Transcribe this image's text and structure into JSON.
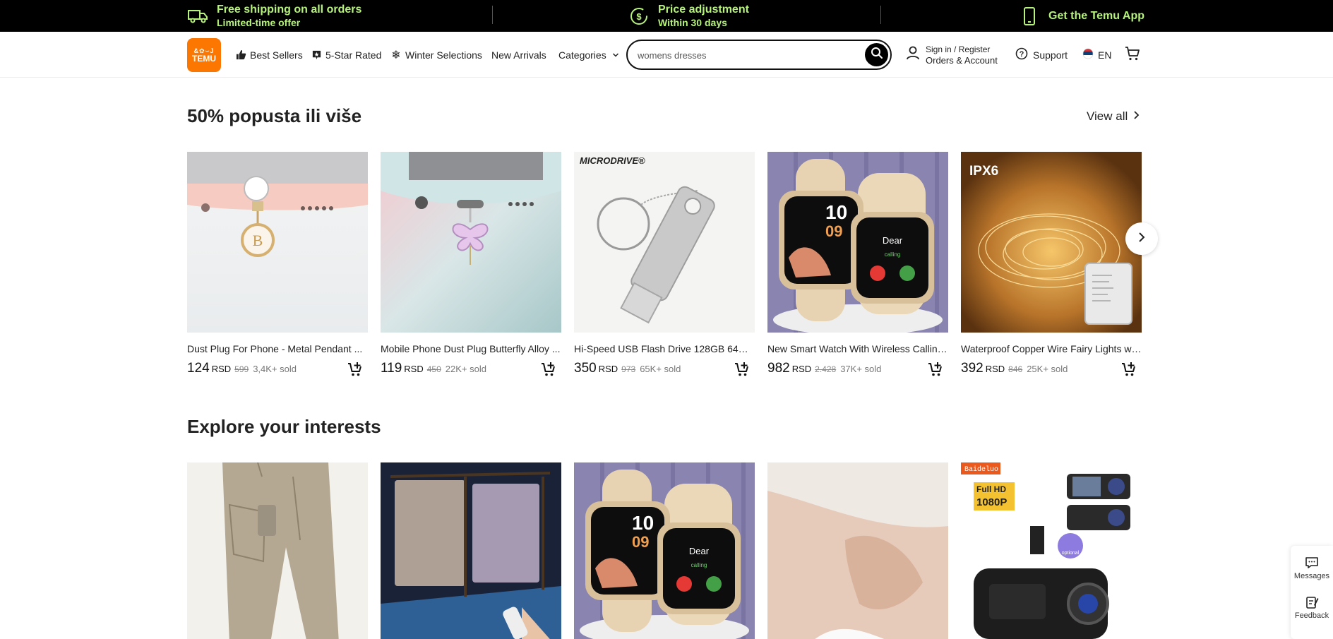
{
  "promo": {
    "shipping_title": "Free shipping on all orders",
    "shipping_sub": "Limited-time offer",
    "price_title": "Price adjustment",
    "price_sub": "Within 30 days",
    "app_label": "Get the Temu App"
  },
  "header": {
    "logo_top": "&✿⌣J",
    "logo_bottom": "TEMU",
    "nav": {
      "best_sellers": "Best Sellers",
      "five_star": "5-Star Rated",
      "winter": "Winter Selections",
      "new_arrivals": "New Arrivals",
      "categories": "Categories"
    },
    "search": {
      "value": "womens dresses"
    },
    "account": {
      "line1": "Sign in / Register",
      "line2": "Orders & Account"
    },
    "support": "Support",
    "language": "EN"
  },
  "sections": {
    "discount": {
      "title": "50% popusta ili više",
      "view_all": "View all",
      "products": [
        {
          "title": "Dust Plug For Phone - Metal Pendant ...",
          "price": "124",
          "currency": "RSD",
          "old": "599",
          "sold": "3,4K+ sold"
        },
        {
          "title": "Mobile Phone Dust Plug Butterfly Alloy ...",
          "price": "119",
          "currency": "RSD",
          "old": "450",
          "sold": "22K+ sold"
        },
        {
          "title": "Hi-Speed USB Flash Drive 128GB 64GB ...",
          "price": "350",
          "currency": "RSD",
          "old": "973",
          "sold": "65K+ sold"
        },
        {
          "title": "New Smart Watch With Wireless Calling...",
          "price": "982",
          "currency": "RSD",
          "old": "2.428",
          "sold": "37K+ sold"
        },
        {
          "title": "Waterproof Copper Wire Fairy Lights wi...",
          "price": "392",
          "currency": "RSD",
          "old": "846",
          "sold": "25K+ sold"
        }
      ],
      "image_text": {
        "microdrive": "MICRODRIVE®",
        "ipx6": "IPX6",
        "watch_hour": "10",
        "watch_min": "09",
        "watch_dear": "Dear",
        "watch_calling": "calling",
        "initial": "B"
      }
    },
    "interests": {
      "title": "Explore your interests",
      "image_text": {
        "brand_badge": "Baideluo",
        "fullhd": "Full HD",
        "res": "1080P",
        "optional": "optional",
        "watch_hour": "10",
        "watch_min": "09",
        "watch_dear": "Dear",
        "watch_calling": "calling"
      }
    }
  },
  "side": {
    "messages": "Messages",
    "feedback": "Feedback"
  },
  "colors": {
    "promo_bg": "#000000",
    "promo_text": "#b6f27c",
    "brand_orange": "#fb7701"
  }
}
